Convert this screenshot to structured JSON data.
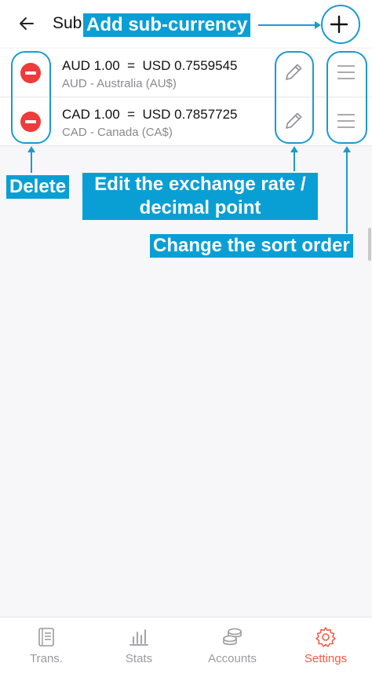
{
  "header": {
    "title": "Sub",
    "back_icon": "arrow-left-icon",
    "add_icon": "plus-icon"
  },
  "currencies": [
    {
      "rate": "AUD 1.00  =  USD 0.7559545",
      "name": "AUD - Australia (AU$)"
    },
    {
      "rate": "CAD 1.00  =  USD 0.7857725",
      "name": "CAD - Canada (CA$)"
    }
  ],
  "callouts": {
    "add": "Add sub-currency",
    "delete": "Delete",
    "edit_line1": "Edit the exchange rate /",
    "edit_line2": "decimal point",
    "sort": "Change the sort order"
  },
  "nav": {
    "items": [
      {
        "label": "Trans.",
        "icon": "ledger-icon"
      },
      {
        "label": "Stats",
        "icon": "bar-chart-icon"
      },
      {
        "label": "Accounts",
        "icon": "coins-icon"
      },
      {
        "label": "Settings",
        "icon": "gear-icon"
      }
    ],
    "active_index": 3
  },
  "colors": {
    "accent_callout": "#0a9fd4",
    "delete_red": "#ee3b3b",
    "active_nav": "#f05a45",
    "inactive_nav": "#9b9b9f"
  }
}
